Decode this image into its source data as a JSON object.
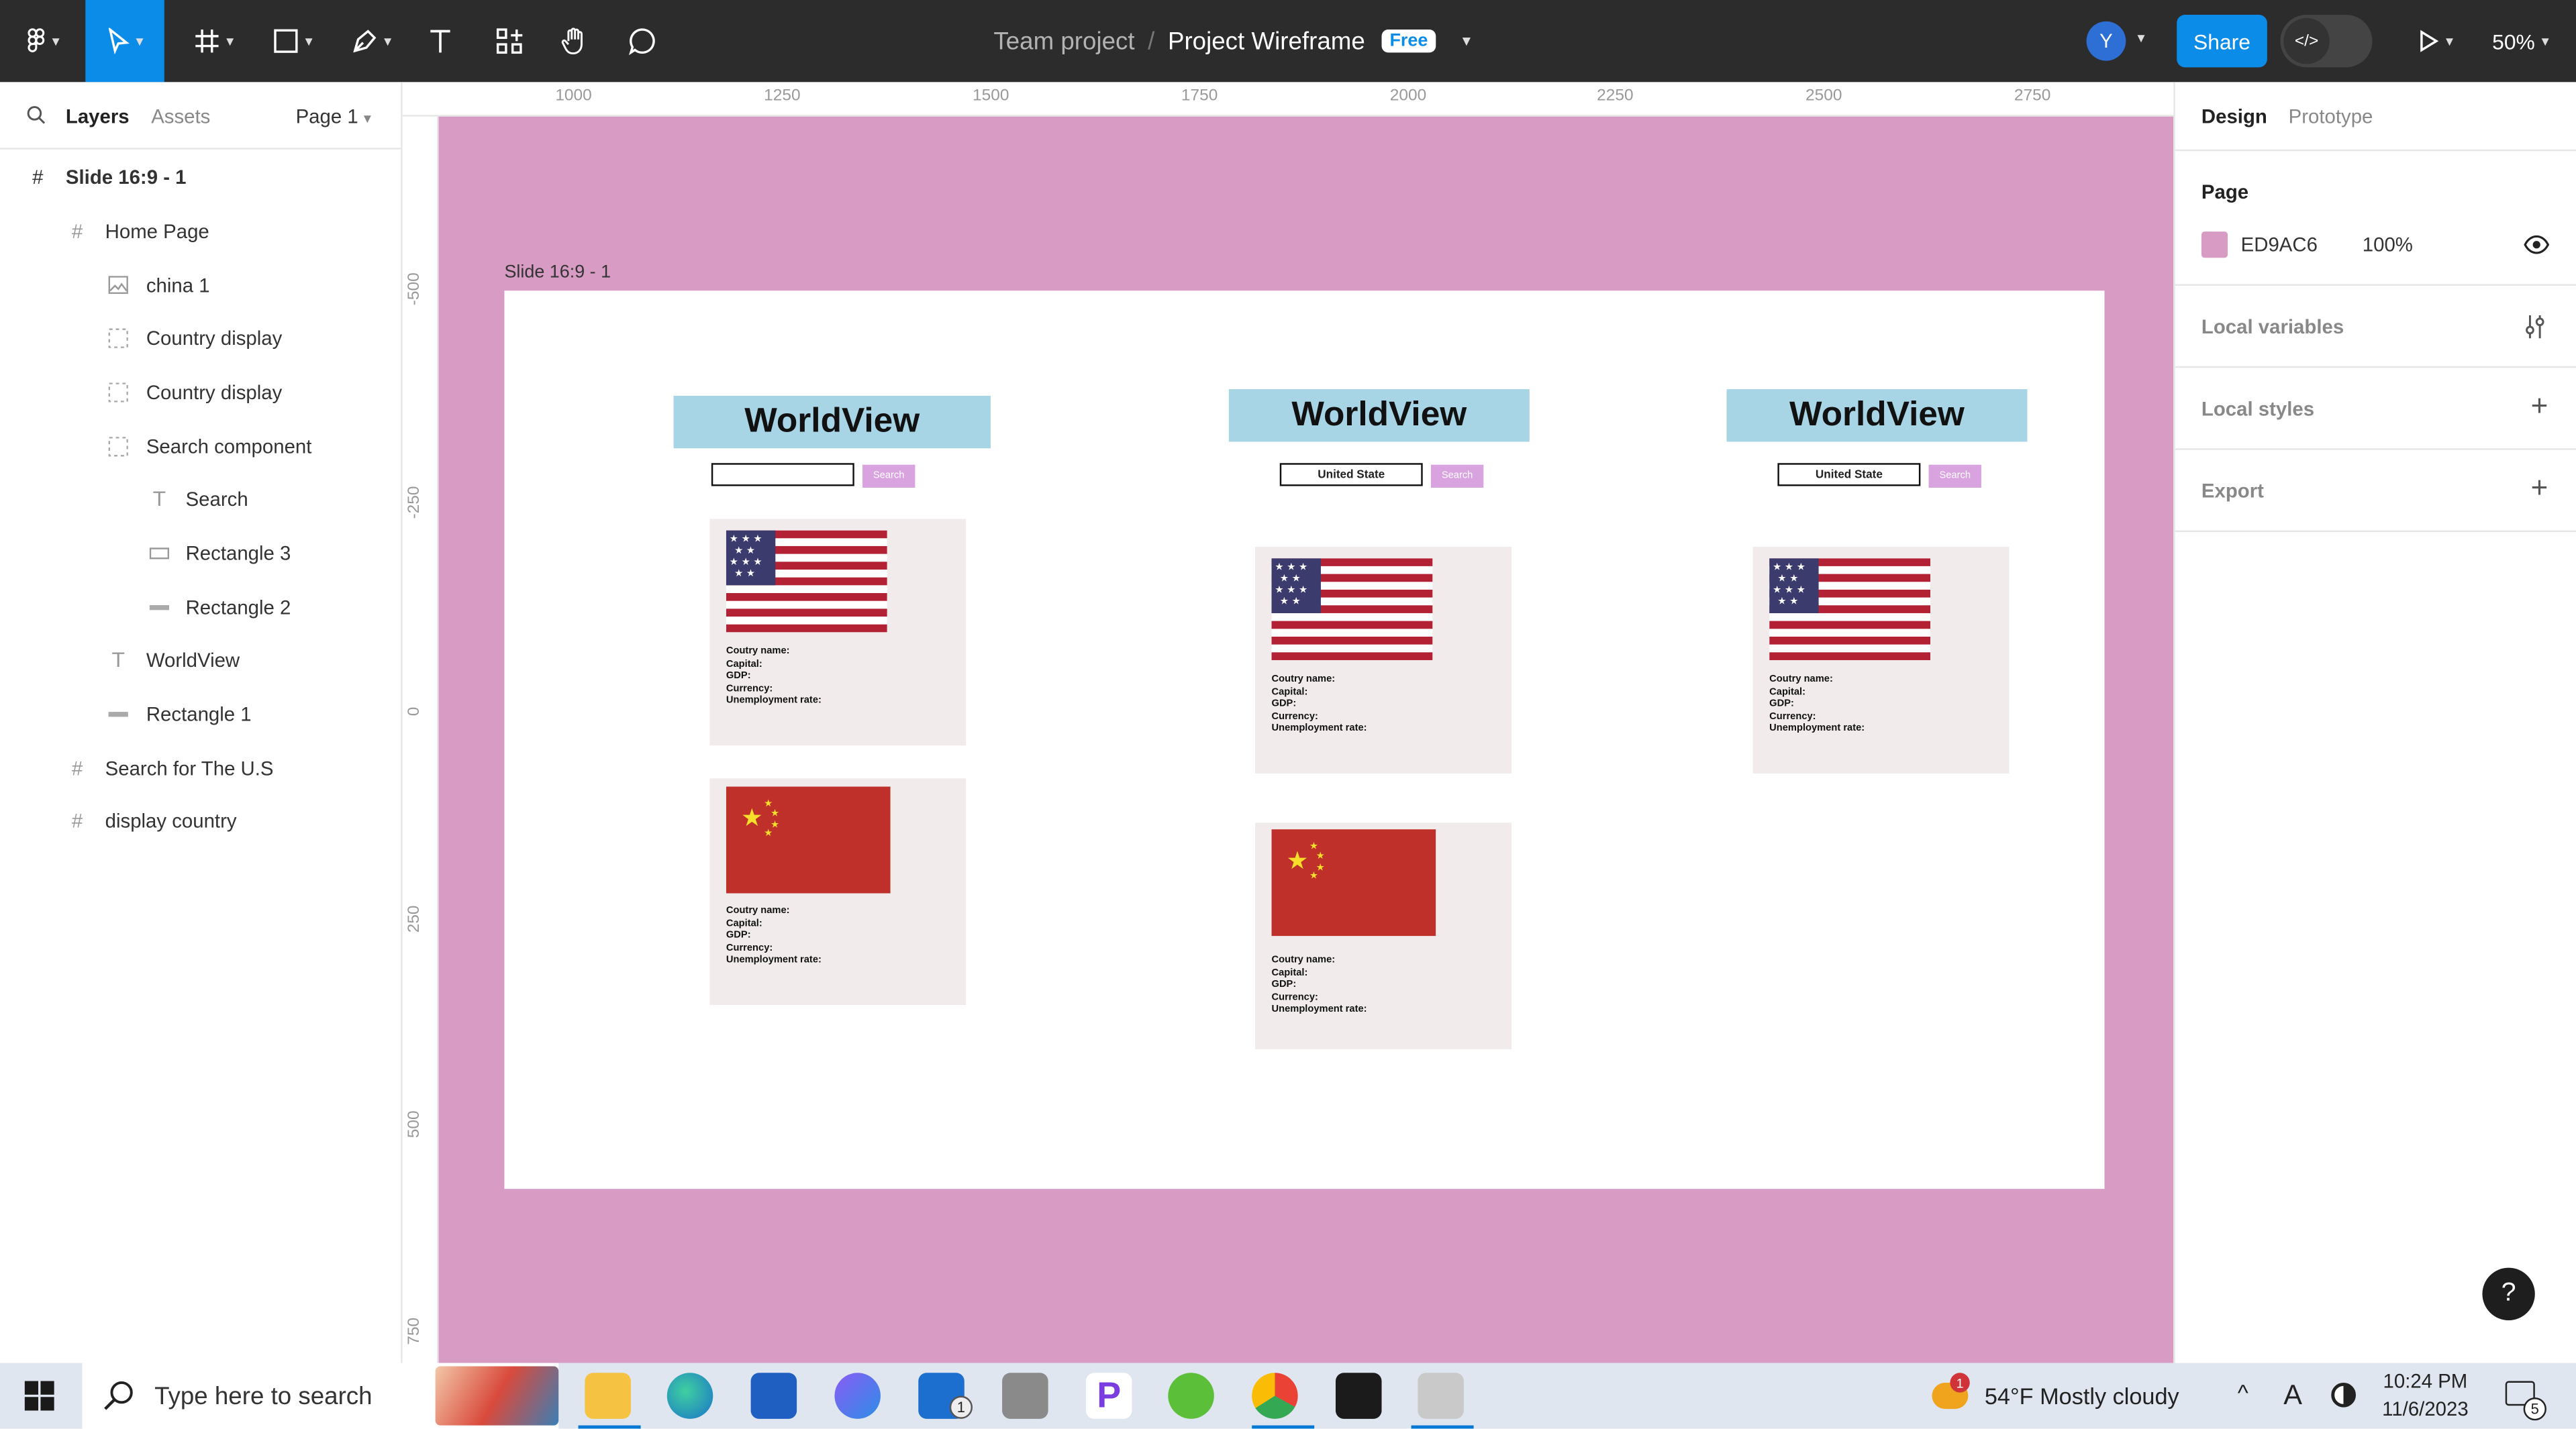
{
  "toolbar": {
    "team": "Team project",
    "separator": "/",
    "project": "Project Wireframe",
    "plan_badge": "Free",
    "avatar_initial": "Y",
    "share_label": "Share",
    "zoom": "50%"
  },
  "left_panel": {
    "tabs": [
      "Layers",
      "Assets"
    ],
    "page_selector": "Page 1",
    "layers": [
      {
        "label": "Slide 16:9 - 1",
        "icon": "frame-icon"
      },
      {
        "label": "Home Page",
        "icon": "frame-icon"
      },
      {
        "label": "china 1",
        "icon": "image-icon"
      },
      {
        "label": "Country display",
        "icon": "section-icon"
      },
      {
        "label": "Country display",
        "icon": "section-icon"
      },
      {
        "label": "Search component",
        "icon": "section-icon"
      },
      {
        "label": "Search",
        "icon": "text-icon"
      },
      {
        "label": "Rectangle 3",
        "icon": "rectangle-icon"
      },
      {
        "label": "Rectangle 2",
        "icon": "line-icon"
      },
      {
        "label": "WorldView",
        "icon": "text-icon"
      },
      {
        "label": "Rectangle 1",
        "icon": "line-icon"
      },
      {
        "label": "Search for The U.S",
        "icon": "frame-icon"
      },
      {
        "label": "display country",
        "icon": "frame-icon"
      }
    ]
  },
  "rulers": {
    "top": [
      "1000",
      "1250",
      "1500",
      "1750",
      "2000",
      "2250",
      "2500",
      "2750"
    ],
    "left": [
      "-500",
      "-250",
      "0",
      "250",
      "500",
      "750"
    ]
  },
  "canvas": {
    "frame_label": "Slide 16:9 - 1",
    "background_color": "#ED9AC6",
    "screens": [
      {
        "title": "WorldView",
        "search_value": "",
        "search_button": "Search"
      },
      {
        "title": "WorldView",
        "search_value": "United State",
        "search_button": "Search"
      },
      {
        "title": "WorldView",
        "search_value": "United State",
        "search_button": "Search"
      }
    ],
    "card_fields": [
      "Coutry name:",
      "Capital:",
      "GDP:",
      "Currency:",
      "Unemployment rate:"
    ]
  },
  "right_panel": {
    "tabs": [
      "Design",
      "Prototype"
    ],
    "page_heading": "Page",
    "page_color": "ED9AC6",
    "page_opacity": "100%",
    "sections": [
      "Local variables",
      "Local styles",
      "Export"
    ]
  },
  "help_label": "?",
  "taskbar": {
    "search_placeholder": "Type here to search",
    "mail_badge": "1",
    "weather_badge": "1",
    "weather": "54°F  Mostly cloudy",
    "ime": "A",
    "time": "10:24 PM",
    "date": "11/6/2023",
    "notification_count": "5"
  }
}
